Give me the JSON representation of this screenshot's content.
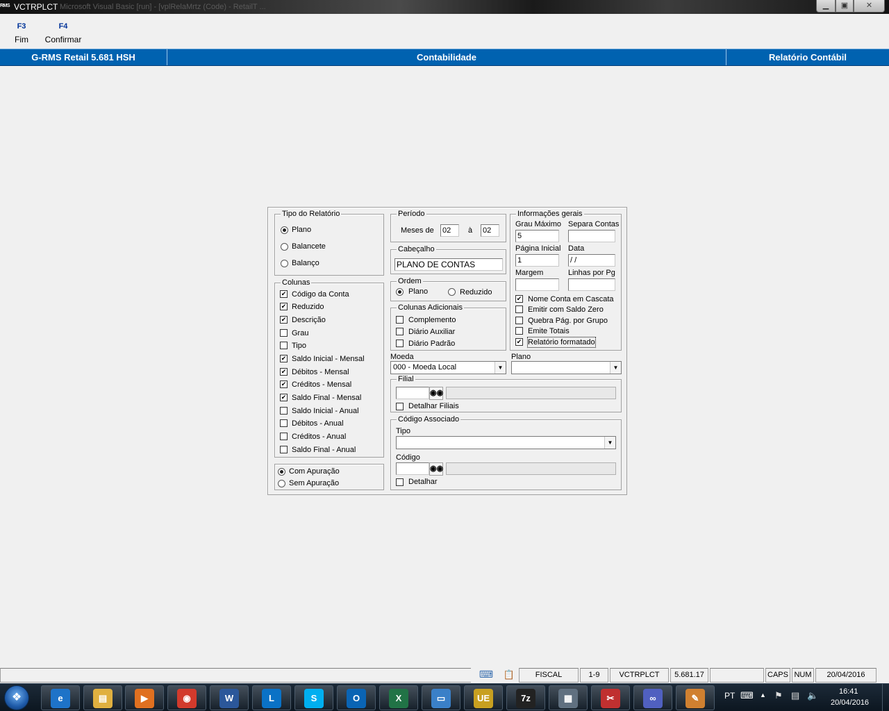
{
  "window": {
    "logo_text": "RMS",
    "title": "VCTRPLCT",
    "ghost_tabs": "Microsoft Visual Basic [run] - [vplRelaMrtz (Code) - RetailT ...",
    "buttons": {
      "minimize": "▁",
      "maximize": "▣",
      "close": "✕"
    }
  },
  "function_keys": [
    {
      "key": "F3",
      "label": "Fim"
    },
    {
      "key": "F4",
      "label": "Confirmar"
    }
  ],
  "header": {
    "app": "G-RMS Retail 5.681 HSH",
    "module": "Contabilidade",
    "screen": "Relatório Contábil"
  },
  "form": {
    "tipo_relatorio": {
      "caption": "Tipo do Relatório",
      "options": [
        {
          "label": "Plano",
          "selected": true
        },
        {
          "label": "Balancete",
          "selected": false
        },
        {
          "label": "Balanço",
          "selected": false
        }
      ]
    },
    "colunas": {
      "caption": "Colunas",
      "items": [
        {
          "label": "Código da Conta",
          "checked": true
        },
        {
          "label": "Reduzido",
          "checked": true
        },
        {
          "label": "Descrição",
          "checked": true
        },
        {
          "label": "Grau",
          "checked": false
        },
        {
          "label": "Tipo",
          "checked": false
        },
        {
          "label": "Saldo Inicial - Mensal",
          "checked": true
        },
        {
          "label": "Débitos - Mensal",
          "checked": true
        },
        {
          "label": "Créditos - Mensal",
          "checked": true
        },
        {
          "label": "Saldo Final - Mensal",
          "checked": true
        },
        {
          "label": "Saldo Inicial - Anual",
          "checked": false
        },
        {
          "label": "Débitos - Anual",
          "checked": false
        },
        {
          "label": "Créditos - Anual",
          "checked": false
        },
        {
          "label": "Saldo Final - Anual",
          "checked": false
        }
      ]
    },
    "apuracao": {
      "options": [
        {
          "label": "Com Apuração",
          "selected": true
        },
        {
          "label": "Sem Apuração",
          "selected": false
        }
      ]
    },
    "periodo": {
      "caption": "Período",
      "meses_de_label": "Meses de",
      "de_value": "02",
      "a_label": "à",
      "ate_value": "02"
    },
    "cabecalho": {
      "caption": "Cabeçalho",
      "value": "PLANO DE CONTAS"
    },
    "ordem": {
      "caption": "Ordem",
      "options": [
        {
          "label": "Plano",
          "selected": true
        },
        {
          "label": "Reduzido",
          "selected": false
        }
      ]
    },
    "colunas_adicionais": {
      "caption": "Colunas Adicionais",
      "items": [
        {
          "label": "Complemento",
          "checked": false
        },
        {
          "label": "Diário Auxiliar",
          "checked": false
        },
        {
          "label": "Diário Padrão",
          "checked": false
        }
      ]
    },
    "informacoes_gerais": {
      "caption": "Informações gerais",
      "grau_maximo_label": "Grau Máximo",
      "grau_maximo_value": "5",
      "separa_contas_label": "Separa Contas",
      "separa_contas_value": "",
      "pagina_inicial_label": "Página Inicial",
      "pagina_inicial_value": "1",
      "data_label": "Data",
      "data_value": " /  /",
      "margem_label": "Margem",
      "margem_value": "",
      "linhas_por_pg_label": "Linhas por Pg",
      "linhas_por_pg_value": "",
      "checks": [
        {
          "label": "Nome Conta em Cascata",
          "checked": true
        },
        {
          "label": "Emitir com Saldo Zero",
          "checked": false
        },
        {
          "label": "Quebra Pág. por Grupo",
          "checked": false
        },
        {
          "label": "Emite Totais",
          "checked": false
        },
        {
          "label": "Relatório formatado",
          "checked": true
        }
      ]
    },
    "moeda": {
      "label": "Moeda",
      "value": "000 - Moeda Local"
    },
    "plano": {
      "label": "Plano",
      "value": ""
    },
    "filial": {
      "caption": "Filial",
      "code_value": "",
      "desc_value": "",
      "detalhar_label": "Detalhar Filiais",
      "detalhar_checked": false
    },
    "codigo_associado": {
      "caption": "Código Associado",
      "tipo_label": "Tipo",
      "tipo_value": "",
      "codigo_label": "Código",
      "codigo_value": "",
      "desc_value": "",
      "detalhar_label": "Detalhar",
      "detalhar_checked": false
    },
    "binoculars_icon": "binoculars-icon"
  },
  "statusbar": {
    "cells": [
      "FISCAL",
      "1-9",
      "VCTRPLCT",
      "5.681.17",
      "",
      "CAPS",
      "NUM",
      "20/04/2016"
    ]
  },
  "taskbar": {
    "apps": [
      {
        "name": "internet-explorer",
        "glyph": "e",
        "color": "#1e73c8"
      },
      {
        "name": "file-explorer",
        "glyph": "▤",
        "color": "#e0b040"
      },
      {
        "name": "media-player",
        "glyph": "▶",
        "color": "#e07020"
      },
      {
        "name": "chrome",
        "glyph": "◉",
        "color": "#d23a2c"
      },
      {
        "name": "word",
        "glyph": "W",
        "color": "#2b579a"
      },
      {
        "name": "lync",
        "glyph": "L",
        "color": "#0a72c6"
      },
      {
        "name": "skype",
        "glyph": "S",
        "color": "#00aff0"
      },
      {
        "name": "outlook",
        "glyph": "O",
        "color": "#0a64b4"
      },
      {
        "name": "excel",
        "glyph": "X",
        "color": "#217346"
      },
      {
        "name": "remote-desktop",
        "glyph": "▭",
        "color": "#3a80c8"
      },
      {
        "name": "ultraedit",
        "glyph": "UE",
        "color": "#c8a020"
      },
      {
        "name": "7zip",
        "glyph": "7z",
        "color": "#222222"
      },
      {
        "name": "calculator-app",
        "glyph": "▦",
        "color": "#607080"
      },
      {
        "name": "snipping-tool",
        "glyph": "✂",
        "color": "#c03030"
      },
      {
        "name": "infinity-app",
        "glyph": "∞",
        "color": "#5060c0"
      },
      {
        "name": "paint",
        "glyph": "✎",
        "color": "#d08030"
      }
    ],
    "tray_lang": "PT",
    "time": "16:41",
    "date": "20/04/2016"
  },
  "colors": {
    "header_blue": "#0062b0",
    "window_bg": "#f0f0f0"
  }
}
